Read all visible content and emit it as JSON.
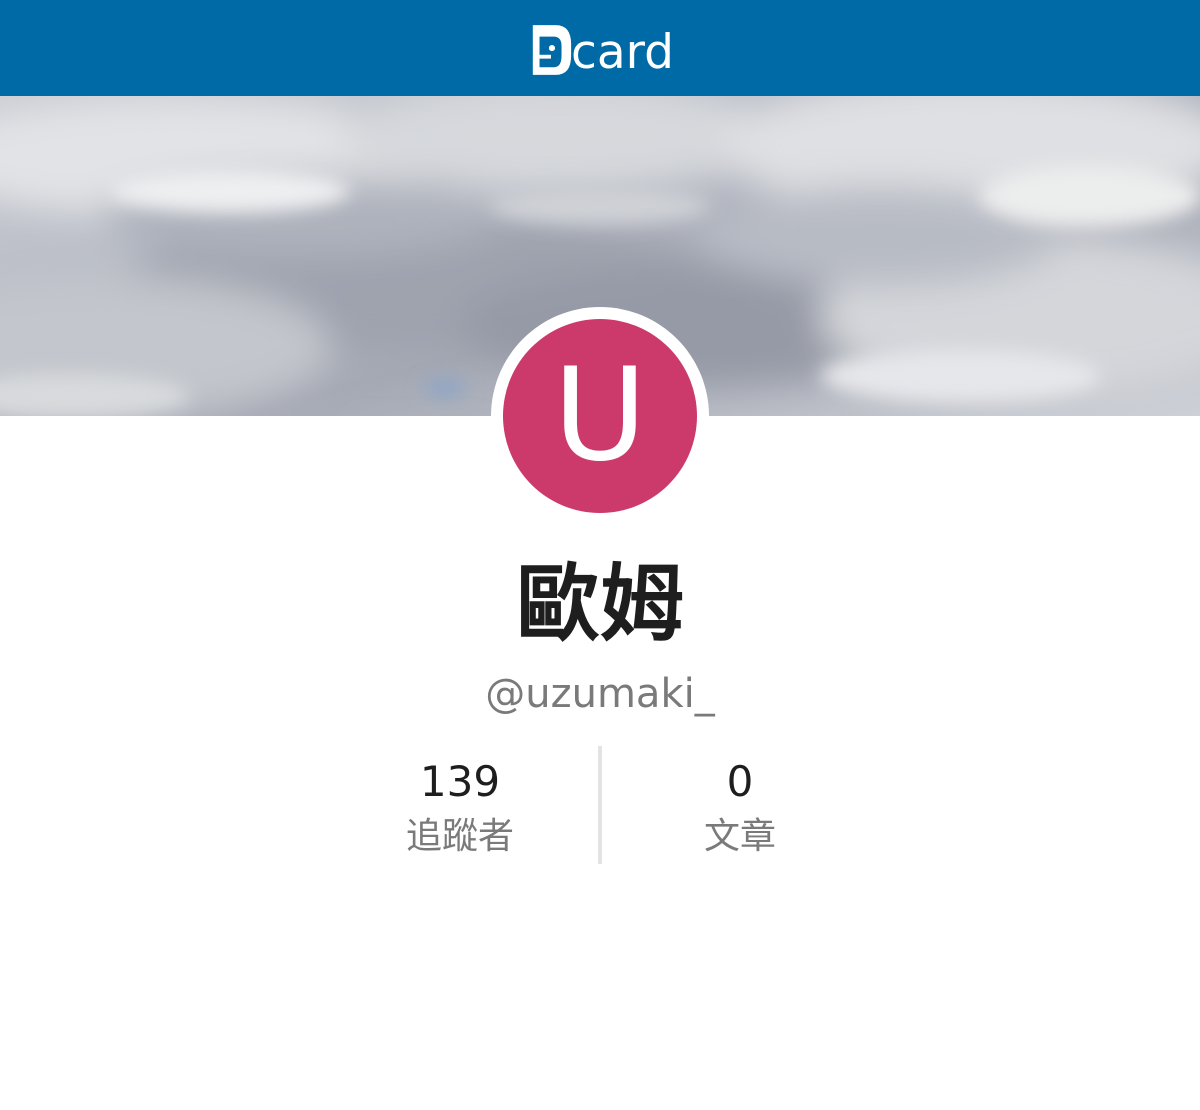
{
  "header": {
    "logo_text": "card",
    "logo_label": "Dcard logo",
    "background_color": "#006aa6"
  },
  "profile": {
    "avatar_letter": "U",
    "avatar_color": "#cc3a6c",
    "display_name": "歐姆",
    "handle": "@uzumaki_"
  },
  "stats": [
    {
      "value": "139",
      "label": "追蹤者"
    },
    {
      "value": "0",
      "label": "文章"
    }
  ],
  "cover": {
    "description": "cloudy sky"
  }
}
